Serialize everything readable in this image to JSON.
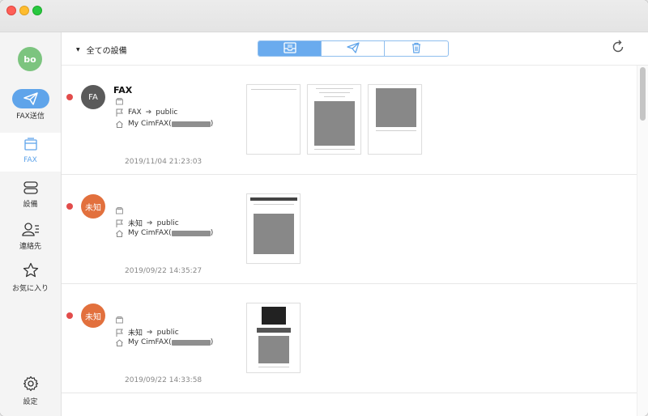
{
  "user": {
    "initials": "bo"
  },
  "sidebar": {
    "items": [
      {
        "label": "FAX送信",
        "icon": "paper-plane-icon"
      },
      {
        "label": "FAX",
        "icon": "folder-icon"
      },
      {
        "label": "設備",
        "icon": "server-icon"
      },
      {
        "label": "連絡先",
        "icon": "contact-icon"
      },
      {
        "label": "お気に入り",
        "icon": "star-icon"
      },
      {
        "label": "設定",
        "icon": "gear-icon"
      }
    ]
  },
  "toolbar": {
    "device_filter": "全ての設備",
    "segments": [
      "inbox-icon",
      "paper-plane-icon",
      "trash-icon"
    ],
    "refresh_icon": "refresh-icon"
  },
  "colors": {
    "accent": "#5fa4ea",
    "unread": "#e24c4b",
    "avatar_user": "#7cc47f",
    "avatar_fax": "#5a5a5a",
    "avatar_unknown": "#e2703d"
  },
  "messages": [
    {
      "avatar": "FA",
      "title": "FAX",
      "from": "FAX",
      "to": "public",
      "device": "My CimFAX(",
      "device_suffix": ")",
      "date": "2019/11/04 21:23:03"
    },
    {
      "avatar": "未知",
      "title": "",
      "from": "未知",
      "to": "public",
      "device": "My CimFAX(",
      "device_suffix": ")",
      "date": "2019/09/22 14:35:27"
    },
    {
      "avatar": "未知",
      "title": "",
      "from": "未知",
      "to": "public",
      "device": "My CimFAX(",
      "device_suffix": ")",
      "date": "2019/09/22 14:33:58"
    }
  ]
}
